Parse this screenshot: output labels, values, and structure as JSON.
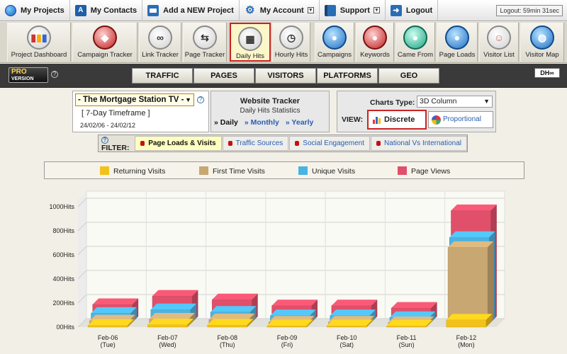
{
  "topnav": {
    "items": [
      {
        "label": "My Projects",
        "icon": "globe-icon"
      },
      {
        "label": "My Contacts",
        "icon": "contact-card-icon"
      },
      {
        "label": "Add a NEW Project",
        "icon": "new-project-icon"
      },
      {
        "label": "My Account",
        "icon": "gear-icon"
      },
      {
        "label": "Support",
        "icon": "book-icon"
      },
      {
        "label": "Logout",
        "icon": "logout-icon"
      }
    ],
    "logout_timer": "Logout: 59min 31sec"
  },
  "toolbar": {
    "items": [
      {
        "label": "Project Dashboard",
        "icon": "dashboard-icon"
      },
      {
        "label": "Campaign Tracker",
        "icon": "campaign-icon"
      },
      {
        "label": "Link Tracker",
        "icon": "link-icon"
      },
      {
        "label": "Page Tracker",
        "icon": "page-tracker-icon"
      },
      {
        "label": "Daily Hits",
        "icon": "calendar-icon"
      },
      {
        "label": "Hourly Hits",
        "icon": "clock-icon"
      },
      {
        "label": "Campaigns",
        "icon": "campaigns-icon"
      },
      {
        "label": "Keywords",
        "icon": "keywords-icon"
      },
      {
        "label": "Came From",
        "icon": "came-from-icon"
      },
      {
        "label": "Page Loads",
        "icon": "page-loads-icon"
      },
      {
        "label": "Visitor List",
        "icon": "visitor-list-icon"
      },
      {
        "label": "Visitor Map",
        "icon": "globe-map-icon"
      }
    ],
    "active": "Daily Hits"
  },
  "secondbar": {
    "pro_label": "PRO",
    "version_label": "VERSION",
    "tabs": [
      "TRAFFIC",
      "PAGES",
      "VISITORS",
      "PLATFORMS",
      "GEO"
    ],
    "dh_label": "DH"
  },
  "project_panel": {
    "project": "- The Mortgage Station TV -",
    "timeframe": "[ 7-Day Timeframe ]",
    "date_range": "24/02/06 - 24/02/12"
  },
  "tracker_panel": {
    "title": "Website Tracker",
    "subtitle": "Daily Hits Statistics",
    "links": [
      "» Daily",
      "» Monthly",
      "» Yearly"
    ]
  },
  "view_panel": {
    "charts_type_label": "Charts Type:",
    "charts_type_value": "3D Column",
    "view_label": "VIEW:",
    "discrete": "Discrete",
    "proportional": "Proportional"
  },
  "filter": {
    "label": "FILTER:",
    "tabs": [
      "Page Loads & Visits",
      "Traffic Sources",
      "Social Engagement",
      "National Vs International"
    ],
    "active": "Page Loads & Visits"
  },
  "chart_data": {
    "type": "bar",
    "categories": [
      "Feb-06\n(Tue)",
      "Feb-07\n(Wed)",
      "Feb-08\n(Thu)",
      "Feb-09\n(Fri)",
      "Feb-10\n(Sat)",
      "Feb-11\n(Sun)",
      "Feb-12\n(Mon)"
    ],
    "series": [
      {
        "name": "Returning Visits",
        "color": "#f2c21b",
        "values": [
          15,
          20,
          18,
          12,
          12,
          10,
          60
        ]
      },
      {
        "name": "First Time Visits",
        "color": "#c8a772",
        "values": [
          40,
          55,
          50,
          30,
          30,
          25,
          650
        ]
      },
      {
        "name": "Unique Visits",
        "color": "#4bb3e0",
        "values": [
          90,
          120,
          100,
          70,
          70,
          55,
          720
        ]
      },
      {
        "name": "Page Views",
        "color": "#e0506a",
        "values": [
          150,
          220,
          190,
          140,
          140,
          120,
          930
        ]
      }
    ],
    "y_ticks": [
      "00Hits",
      "200Hits",
      "400Hits",
      "600Hits",
      "800Hits",
      "1000Hits"
    ],
    "ylim": [
      0,
      1000
    ],
    "grid": true
  }
}
